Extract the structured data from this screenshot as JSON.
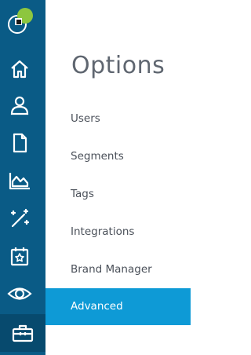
{
  "sidebar": {
    "icons": [
      {
        "name": "home-icon",
        "active": false
      },
      {
        "name": "user-icon",
        "active": false
      },
      {
        "name": "document-icon",
        "active": false
      },
      {
        "name": "area-chart-icon",
        "active": false
      },
      {
        "name": "magic-wand-icon",
        "active": false
      },
      {
        "name": "calendar-star-icon",
        "active": false
      },
      {
        "name": "eye-icon",
        "active": false
      },
      {
        "name": "toolbox-icon",
        "active": true
      }
    ],
    "logo": {
      "colors": [
        "#8dc63f",
        "#2a2a2a",
        "#ffffff"
      ]
    }
  },
  "panel": {
    "title": "Options",
    "items": [
      {
        "label": "Users",
        "selected": false
      },
      {
        "label": "Segments",
        "selected": false
      },
      {
        "label": "Tags",
        "selected": false
      },
      {
        "label": "Integrations",
        "selected": false
      },
      {
        "label": "Brand Manager",
        "selected": false
      },
      {
        "label": "Advanced",
        "selected": true
      }
    ]
  },
  "colors": {
    "rail": "#0a5b86",
    "rail_active": "#074a6e",
    "accent": "#0e9ad6",
    "text": "#4a5059",
    "title": "#5f6670"
  }
}
